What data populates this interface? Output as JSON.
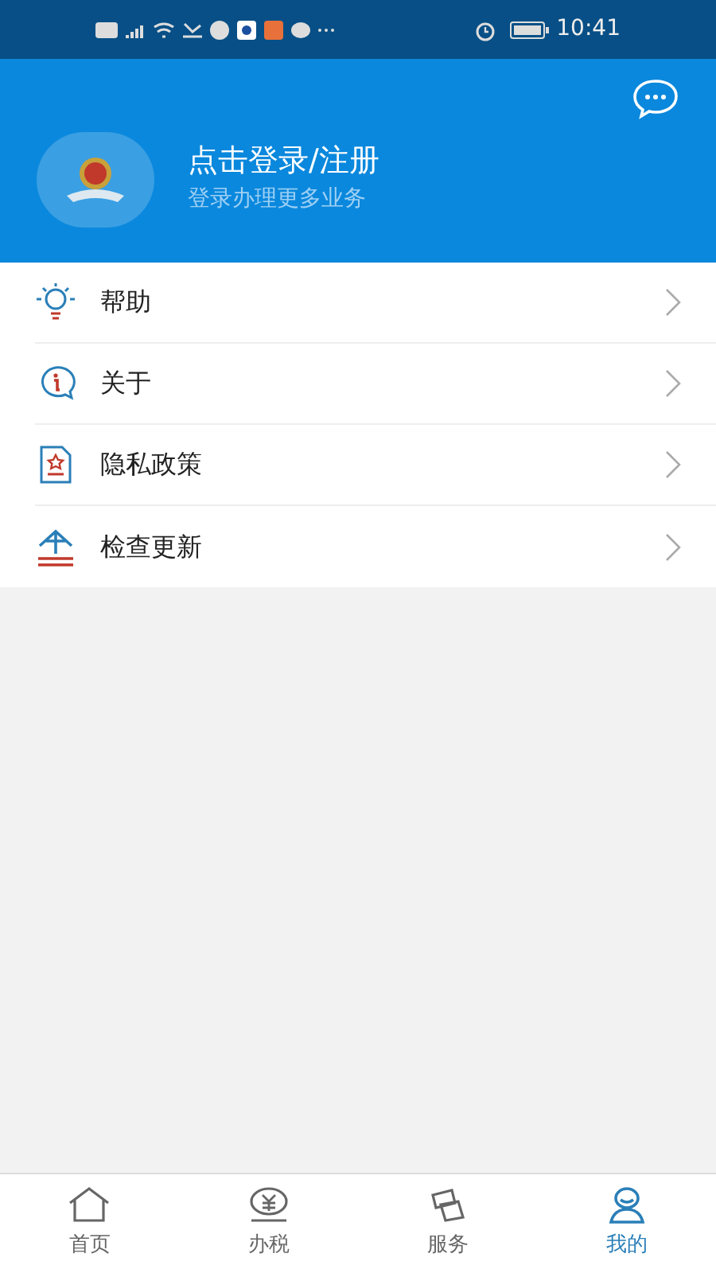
{
  "status_bar": {
    "time": "10:41"
  },
  "profile": {
    "title": "点击登录/注册",
    "subtitle": "登录办理更多业务"
  },
  "menu": [
    {
      "kind": "help",
      "label": "帮助"
    },
    {
      "kind": "about",
      "label": "关于"
    },
    {
      "kind": "privacy",
      "label": "隐私政策"
    },
    {
      "kind": "update",
      "label": "检查更新"
    }
  ],
  "tabs": [
    {
      "kind": "home",
      "label": "首页",
      "selected": false
    },
    {
      "kind": "tax",
      "label": "办税",
      "selected": false
    },
    {
      "kind": "service",
      "label": "服务",
      "selected": false
    },
    {
      "kind": "mine",
      "label": "我的",
      "selected": true
    }
  ]
}
